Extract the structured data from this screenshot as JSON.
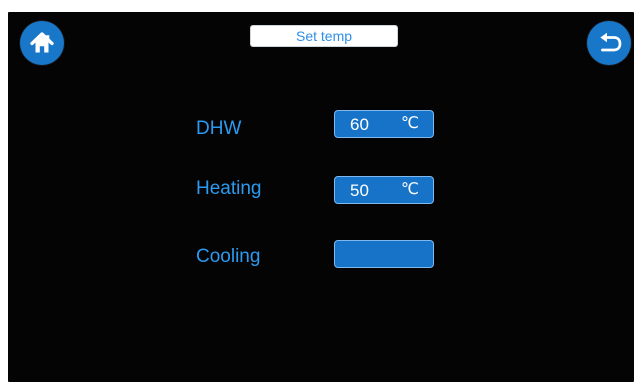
{
  "colors": {
    "screen_background": "#050404",
    "page_border": "#ffffff",
    "accent_blue": "#1877c9",
    "label_blue": "#2b9af0",
    "field_blue": "#1773c8",
    "title_text": "#2e8fe8",
    "white": "#ffffff"
  },
  "header": {
    "home_icon": "home-icon",
    "title": "Set temp",
    "back_icon": "back-icon"
  },
  "settings": {
    "rows": [
      {
        "label": "DHW",
        "value": "60",
        "unit": "℃"
      },
      {
        "label": "Heating",
        "value": "50",
        "unit": "℃"
      },
      {
        "label": "Cooling",
        "value": "",
        "unit": ""
      }
    ]
  }
}
